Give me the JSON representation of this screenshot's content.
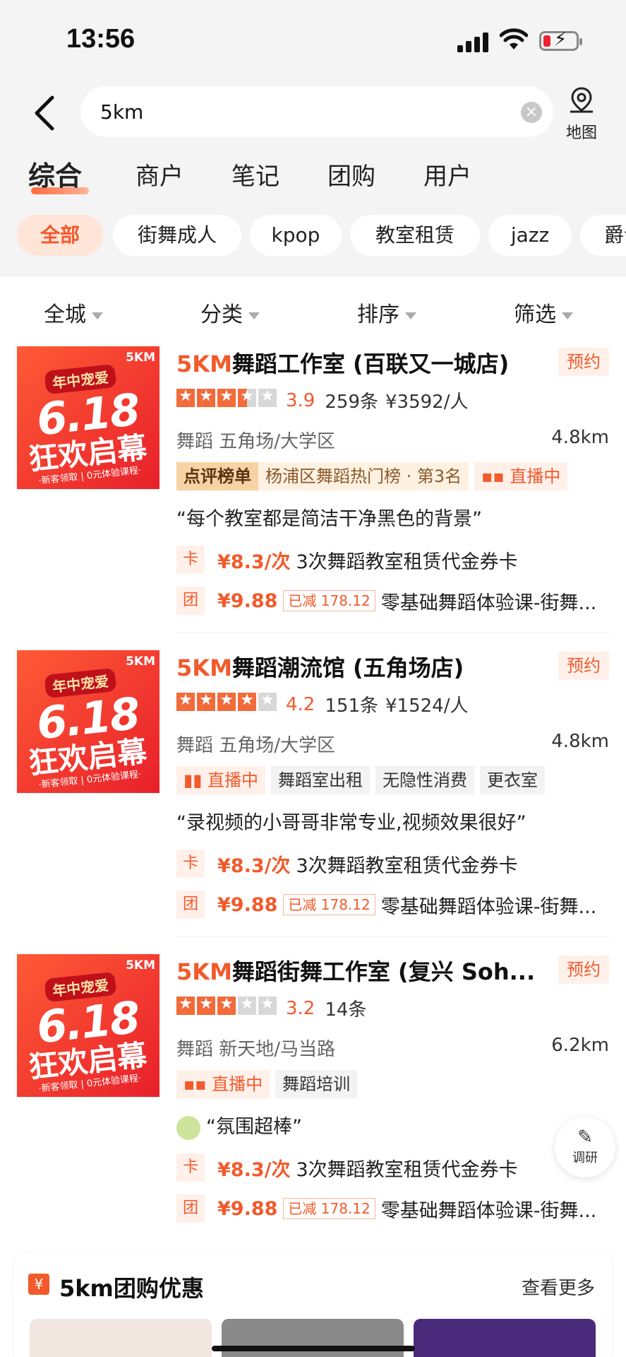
{
  "status": {
    "time": "13:56"
  },
  "search": {
    "query": "5km",
    "map_label": "地图"
  },
  "tabs": [
    "综合",
    "商户",
    "笔记",
    "团购",
    "用户"
  ],
  "chips": [
    "全部",
    "街舞成人",
    "kpop",
    "教室租赁",
    "jazz",
    "爵士"
  ],
  "filters": [
    "全城",
    "分类",
    "排序",
    "筛选"
  ],
  "thumb": {
    "brand": "5KM",
    "tag": "年中宠爱",
    "big": "6.18",
    "sub": "狂欢启幕",
    "small": "·新客领取 | 0元体验课程·"
  },
  "items": [
    {
      "brand": "5KM",
      "name": "舞蹈工作室 (百联又一城店)",
      "book": "预约",
      "rating": 3.5,
      "score": "3.9",
      "reviews": "259条",
      "price": "¥3592/人",
      "meta": "舞蹈  五角场/大学区",
      "distance": "4.8km",
      "badges": {
        "rank_key": "点评榜单",
        "rank_val": "杨浦区舞蹈热门榜 · 第3名",
        "live": "直播中"
      },
      "quote": "“每个教室都是简洁干净黑色的背景”",
      "deal1": {
        "icon": "卡",
        "price": "¥8.3/次",
        "text": "3次舞蹈教室租赁代金券卡"
      },
      "deal2": {
        "icon": "团",
        "price": "¥9.88",
        "cut": "已减 178.12",
        "text": "零基础舞蹈体验课-街舞..."
      }
    },
    {
      "brand": "5KM",
      "name": "舞蹈潮流馆 (五角场店)",
      "book": "预约",
      "rating": 4,
      "score": "4.2",
      "reviews": "151条",
      "price": "¥1524/人",
      "meta": "舞蹈  五角场/大学区",
      "distance": "4.8km",
      "badges": {
        "live": "直播中",
        "b1": "舞蹈室出租",
        "b2": "无隐性消费",
        "b3": "更衣室"
      },
      "quote": "“录视频的小哥哥非常专业,视频效果很好”",
      "deal1": {
        "icon": "卡",
        "price": "¥8.3/次",
        "text": "3次舞蹈教室租赁代金券卡"
      },
      "deal2": {
        "icon": "团",
        "price": "¥9.88",
        "cut": "已减 178.12",
        "text": "零基础舞蹈体验课-街舞..."
      }
    },
    {
      "brand": "5KM",
      "name": "舞蹈街舞工作室 (复兴 Soh...",
      "book": "预约",
      "rating": 3,
      "score": "3.2",
      "reviews": "14条",
      "meta": "舞蹈  新天地/马当路",
      "distance": "6.2km",
      "badges": {
        "live": "直播中",
        "b1": "舞蹈培训"
      },
      "quote": "“氛围超棒”",
      "deal1": {
        "icon": "卡",
        "price": "¥8.3/次",
        "text": "3次舞蹈教室租赁代金券卡"
      },
      "deal2": {
        "icon": "团",
        "price": "¥9.88",
        "cut": "已减 178.12",
        "text": "零基础舞蹈体验课-街舞..."
      }
    }
  ],
  "feedback": {
    "label": "调研"
  },
  "group": {
    "title": "5km团购优惠",
    "more": "查看更多",
    "icon": "¥"
  },
  "colors": {
    "accent": "#f25a2b",
    "bg": "#f4f4f4"
  }
}
